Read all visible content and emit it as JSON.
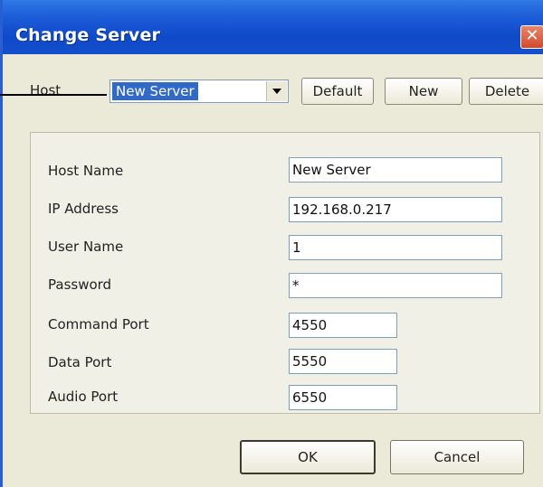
{
  "window": {
    "title": "Change Server",
    "close_glyph": "✕"
  },
  "host": {
    "label": "Host",
    "selected": "New Server"
  },
  "toolbar": {
    "default_label": "Default",
    "new_label": "New",
    "delete_label": "Delete"
  },
  "fields": {
    "host_name": {
      "label": "Host Name",
      "value": "New Server"
    },
    "ip_address": {
      "label": "IP Address",
      "value": "192.168.0.217"
    },
    "user_name": {
      "label": "User Name",
      "value": "1"
    },
    "password": {
      "label": "Password",
      "value": "*"
    },
    "command_port": {
      "label": "Command Port",
      "value": "4550"
    },
    "data_port": {
      "label": "Data Port",
      "value": "5550"
    },
    "audio_port": {
      "label": "Audio Port",
      "value": "6550"
    }
  },
  "footer": {
    "ok_label": "OK",
    "cancel_label": "Cancel"
  },
  "icons": {
    "close": "close-icon",
    "dropdown": "chevron-down-icon"
  },
  "colors": {
    "titlebar": "#0f49c8",
    "selection": "#3169c6",
    "close_button": "#d3492b"
  }
}
